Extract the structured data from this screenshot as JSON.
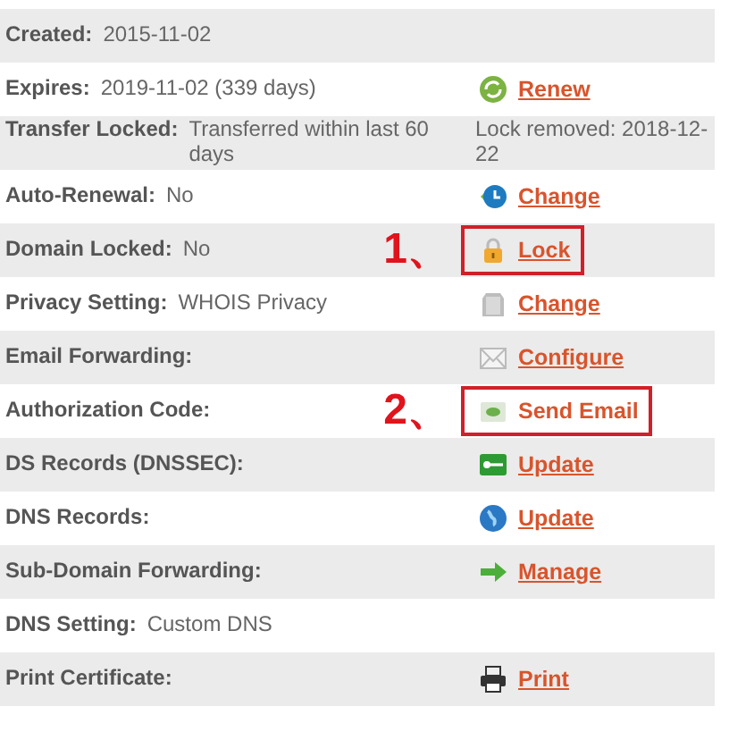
{
  "rows": [
    {
      "label": "Created:",
      "value": "2015-11-02"
    },
    {
      "label": "Expires:",
      "value": "2019-11-02 (339 days)",
      "action": {
        "text": "Renew",
        "underlined": true,
        "highlighted": false
      }
    },
    {
      "label": "Transfer Locked:",
      "value": "Transferred within last 60 days",
      "note": "Lock removed: 2018-12-22"
    },
    {
      "label": "Auto-Renewal:",
      "value": "No",
      "action": {
        "text": "Change",
        "underlined": true,
        "highlighted": false
      }
    },
    {
      "label": "Domain Locked:",
      "value": "No",
      "annotation": "1、",
      "action": {
        "text": "Lock",
        "underlined": true,
        "highlighted": true
      }
    },
    {
      "label": "Privacy Setting:",
      "value": "WHOIS Privacy",
      "action": {
        "text": "Change",
        "underlined": true,
        "highlighted": false
      }
    },
    {
      "label": "Email Forwarding:",
      "action": {
        "text": "Configure",
        "underlined": true,
        "highlighted": false
      }
    },
    {
      "label": "Authorization Code:",
      "annotation": "2、",
      "action": {
        "text": "Send Email",
        "underlined": false,
        "highlighted": true
      }
    },
    {
      "label": "DS Records (DNSSEC):",
      "action": {
        "text": "Update",
        "underlined": true,
        "highlighted": false
      }
    },
    {
      "label": "DNS Records:",
      "action": {
        "text": "Update",
        "underlined": true,
        "highlighted": false
      }
    },
    {
      "label": "Sub-Domain Forwarding:",
      "action": {
        "text": "Manage",
        "underlined": true,
        "highlighted": false
      }
    },
    {
      "label": "DNS Setting:",
      "value": "Custom DNS"
    },
    {
      "label": "Print Certificate:",
      "action": {
        "text": "Print",
        "underlined": true,
        "highlighted": false
      }
    }
  ]
}
